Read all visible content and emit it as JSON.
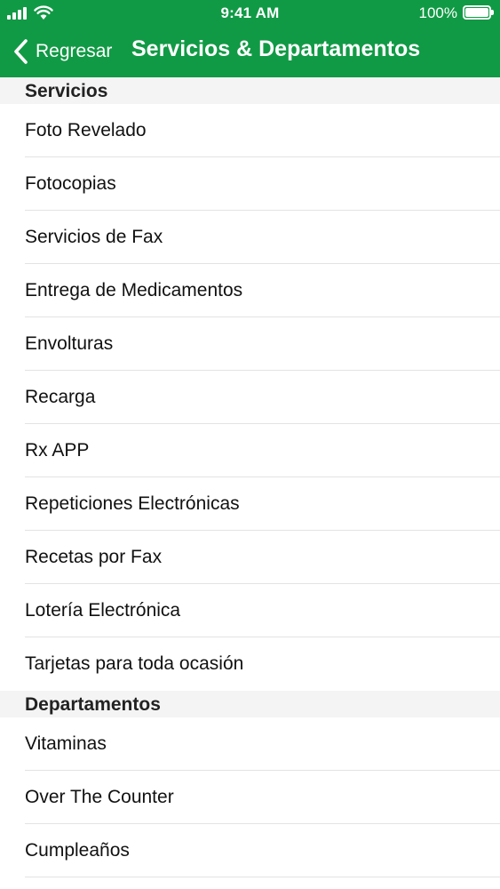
{
  "status_bar": {
    "time": "9:41 AM",
    "battery_percent": "100%",
    "battery_level": 1.0,
    "icons": [
      "signal-icon",
      "wifi-icon",
      "battery-icon"
    ]
  },
  "nav": {
    "back_label": "Regresar",
    "title": "Servicios & Departamentos",
    "bar_color": "#119a45"
  },
  "sections": [
    {
      "header": "Servicios",
      "items": [
        "Foto Revelado",
        "Fotocopias",
        "Servicios de Fax",
        "Entrega de Medicamentos",
        "Envolturas",
        "Recarga",
        "Rx APP",
        "Repeticiones Electrónicas",
        "Recetas por Fax",
        "Lotería Electrónica",
        "Tarjetas para toda ocasión"
      ]
    },
    {
      "header": "Departamentos",
      "items": [
        "Vitaminas",
        "Over The Counter",
        "Cumpleaños"
      ]
    }
  ]
}
